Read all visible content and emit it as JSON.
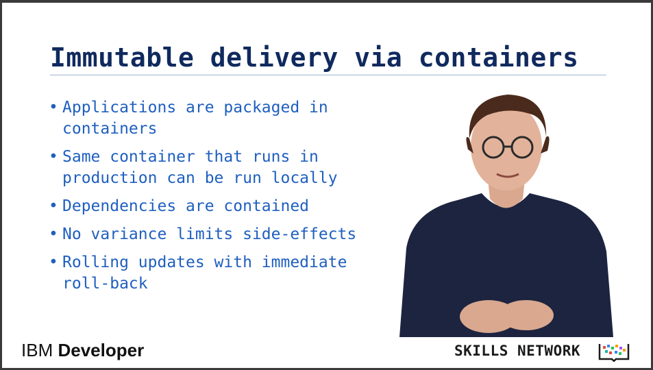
{
  "slide": {
    "title": "Immutable delivery via containers",
    "bullets": [
      "Applications are packaged in containers",
      "Same container that runs in production can be run locally",
      "Dependencies are contained",
      "No variance limits side-effects",
      "Rolling updates with immediate roll-back"
    ],
    "bullet_glyph": "•"
  },
  "branding": {
    "ibm_part": "IBM",
    "developer_part": "Developer",
    "skills_network": "SKILLS NETWORK"
  },
  "colors": {
    "title": "#102a5e",
    "bullet_text": "#1f5fbf",
    "background": "#ffffff"
  }
}
